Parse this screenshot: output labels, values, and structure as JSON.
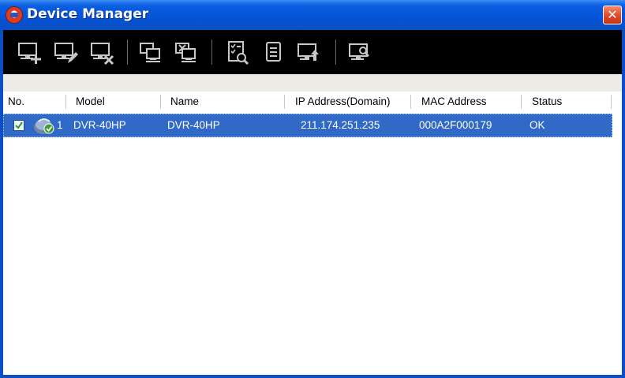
{
  "window": {
    "title": "Device Manager"
  },
  "titlebar": {
    "close_label": "✕"
  },
  "toolbar": {
    "buttons": [
      {
        "icon": "add-device-icon"
      },
      {
        "icon": "edit-device-icon"
      },
      {
        "icon": "delete-device-icon"
      },
      {
        "icon": "connect-device-icon"
      },
      {
        "icon": "disconnect-device-icon"
      },
      {
        "icon": "device-checklist-icon"
      },
      {
        "icon": "device-list-icon"
      },
      {
        "icon": "upgrade-device-icon"
      },
      {
        "icon": "search-device-icon"
      }
    ]
  },
  "table": {
    "columns": [
      "No.",
      "Model",
      "Name",
      "IP Address(Domain)",
      "MAC Address",
      "Status"
    ],
    "rows": [
      {
        "checked": true,
        "no": "1",
        "model": "DVR-40HP",
        "name": "DVR-40HP",
        "ip": "211.174.251.235",
        "mac": "000A2F000179",
        "status": "OK"
      }
    ]
  },
  "colors": {
    "titlebar": "#0553d6",
    "toolbar_bg": "#000000",
    "selection": "#3169c6",
    "close_button": "#e0492a"
  }
}
